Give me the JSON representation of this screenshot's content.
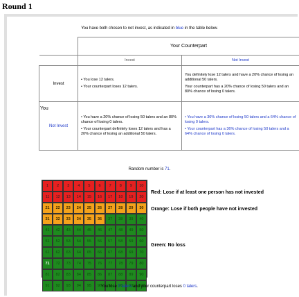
{
  "title": "Round 1",
  "intro": {
    "prefix": "You have both chosen to not invest, as indicated in",
    "highlight": "blue",
    "suffix": "in the table below."
  },
  "table": {
    "counterpart_header": "Your Counterpart",
    "col_invest": "Invest",
    "col_not_invest": "Not Invest",
    "row_label": "You",
    "row_invest": "Invest",
    "row_not_invest": "Not Invest",
    "cell_ii": [
      "• You lose 12 talers.",
      "• Your counterpart loses 12 talers."
    ],
    "cell_in": [
      "You definitely lose 12 talers and have a 20% chance of losing an additional 50 talers.",
      "Your counterpart has a 20% chance of losing 50 talers and an 80% chance of losing 0 talers."
    ],
    "cell_ni": [
      "• You have a 20% chance of losing 50 talers and an 80% chance of losing 0 talers.",
      "• Your counterpart definitely loses 12 talers and has a 20% chance of losing an additional 50 talers."
    ],
    "cell_nn": [
      "• You have a 36% chance of losing 50 talers and a 64% chance of losing 0 talers.",
      "• Your counterpart has a 36% chance of losing 50 talers and a 64% chance of losing 0 talers."
    ]
  },
  "random": {
    "prefix": "Random number is",
    "value": "71",
    "suffix": "."
  },
  "grid": {
    "selected": 71,
    "orange_from": 21,
    "green_from": 37,
    "colors": {
      "red": "#e62020",
      "orange": "#f5a21b",
      "green": "#1e8a1e"
    }
  },
  "legend": {
    "red": "Red: Lose if at least one person has not invested",
    "orange": "Orange: Lose if both people have not invested",
    "green": "Green: No loss"
  },
  "outcome": {
    "p1": "You lose",
    "v1": "0 talers",
    "p2": "and your counterpart loses",
    "v2": "0 talers",
    "end": "."
  }
}
